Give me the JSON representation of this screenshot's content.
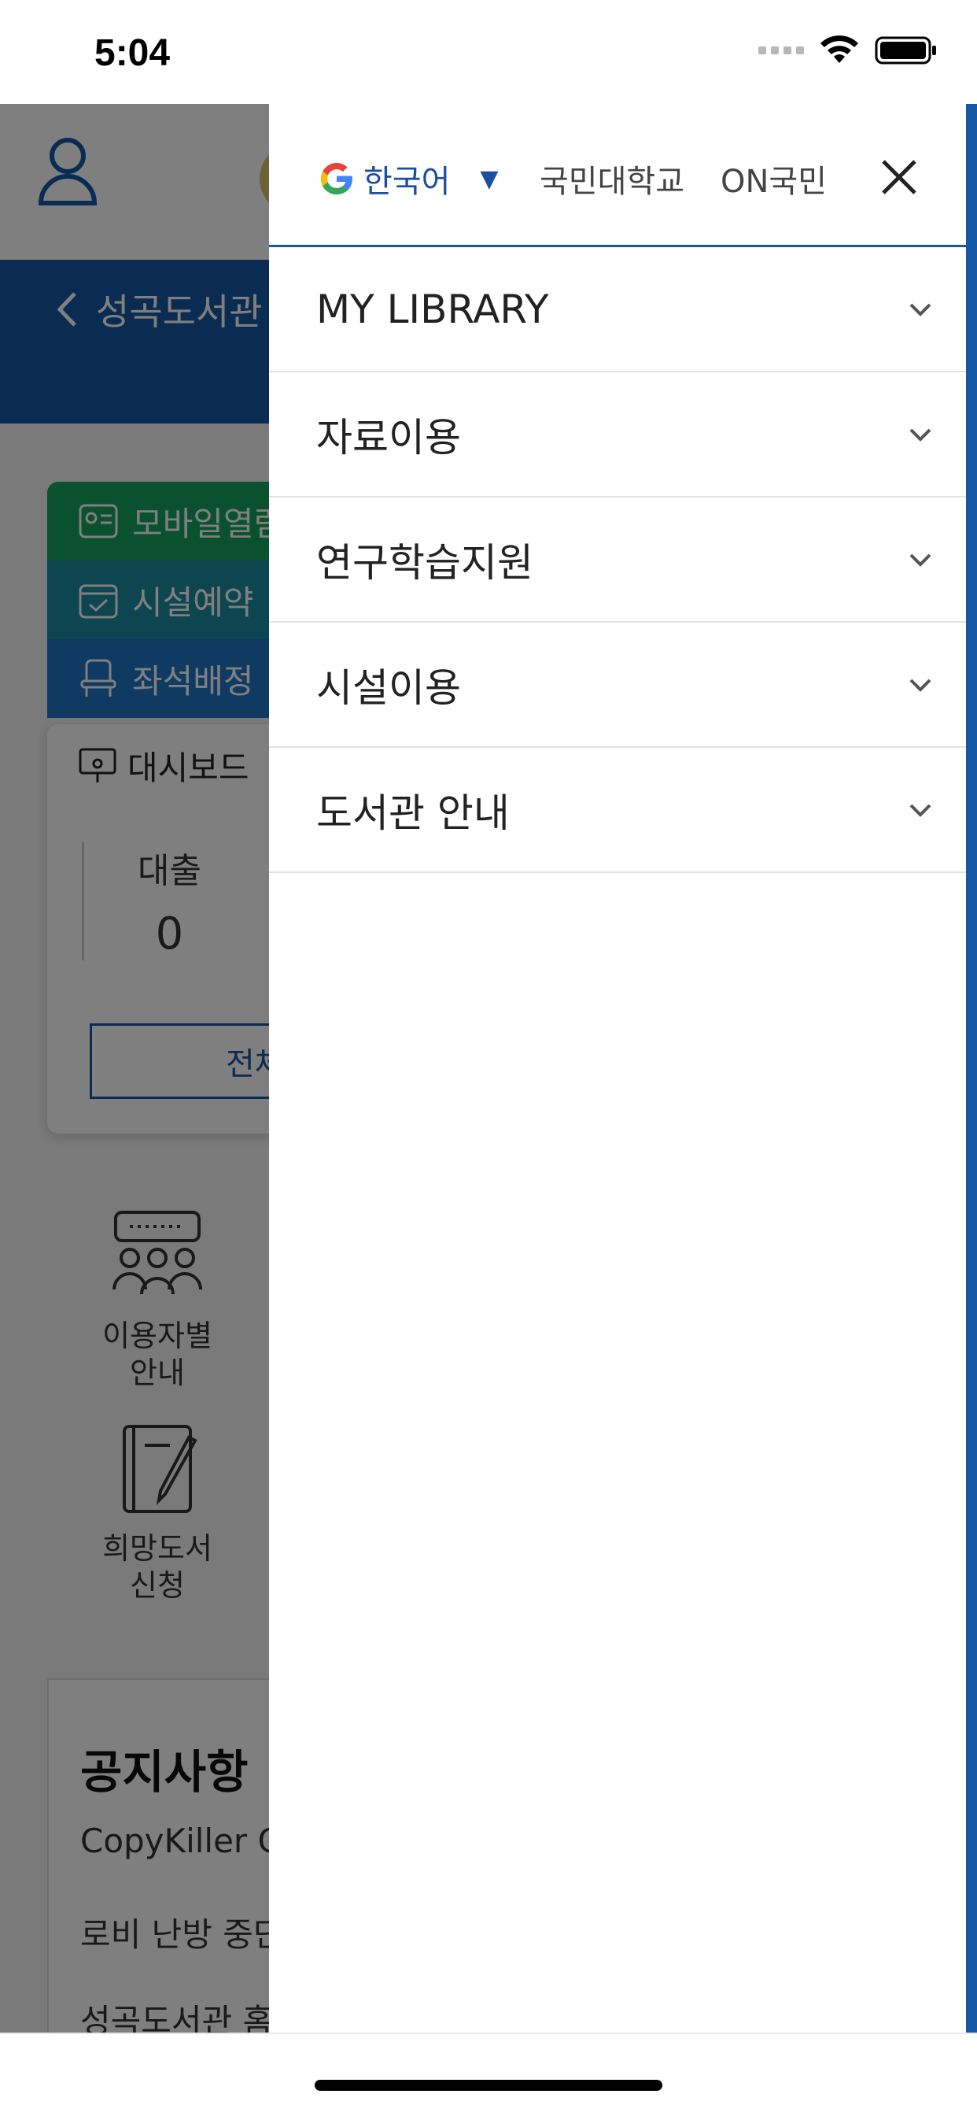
{
  "status_bar": {
    "time": "5:04",
    "icons": [
      "cellular-signal-icon",
      "wifi-icon",
      "battery-icon"
    ]
  },
  "background_app": {
    "banner_title": "성곡도서관",
    "tabs": [
      {
        "label": "모바일열람",
        "icon": "id-card-icon"
      },
      {
        "label": "시설예약",
        "icon": "calendar-check-icon"
      },
      {
        "label": "좌석배정",
        "icon": "chair-icon"
      }
    ],
    "dashboard": {
      "title": "대시보드",
      "stat_label": "대출",
      "stat_value": "0",
      "button_label": "전체"
    },
    "grid_items": [
      {
        "label": "이용자별\n안내",
        "icon": "users-group-icon"
      },
      {
        "label": "희망도서\n신청",
        "icon": "notebook-pen-icon"
      }
    ],
    "notice": {
      "title": "공지사항",
      "rows": [
        "CopyKiller C",
        "로비 난방 중단",
        "성곡도서관 홈"
      ]
    }
  },
  "drawer": {
    "language": {
      "label": "한국어",
      "icon": "google-g-icon",
      "caret": "▼"
    },
    "links": [
      "국민대학교",
      "ON국민"
    ],
    "close_icon": "close-icon",
    "menu": [
      {
        "label": "MY LIBRARY"
      },
      {
        "label": "자료이용"
      },
      {
        "label": "연구학습지원"
      },
      {
        "label": "시설이용"
      },
      {
        "label": "도서관 안내"
      }
    ]
  },
  "colors": {
    "primary": "#1559a6",
    "tab_green": "#14a360",
    "tab_teal": "#1a8aa1",
    "tab_blue": "#1e74c4",
    "divider": "#e3e3e3"
  }
}
